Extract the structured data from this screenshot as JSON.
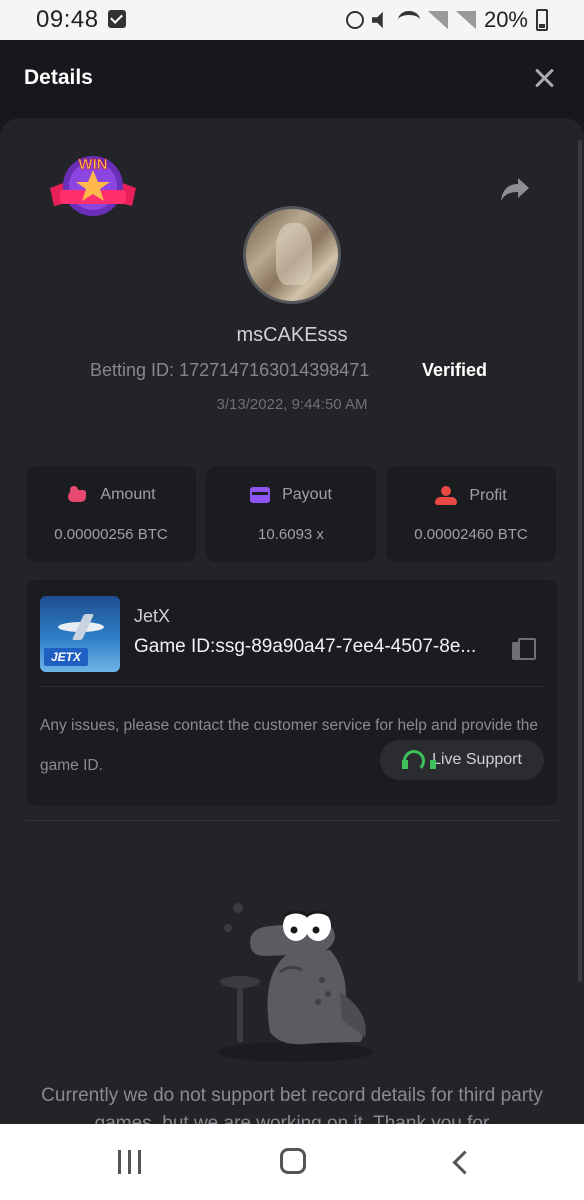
{
  "status_bar": {
    "time": "09:48",
    "battery": "20%",
    "icons": [
      "check-icon",
      "alarm-icon",
      "mute-icon",
      "wifi-icon",
      "signal-icon",
      "signal-icon",
      "battery-icon"
    ]
  },
  "header": {
    "title": "Details",
    "close_icon": "close-icon"
  },
  "profile": {
    "badge_text": "WIN",
    "username": "msCAKEsss",
    "betting_label": "Betting ID:",
    "betting_id": "1727147163014398471",
    "verified": "Verified",
    "date": "3/13/2022, 9:44:50 AM"
  },
  "stats": [
    {
      "label": "Amount",
      "value": "0.00000256 BTC",
      "icon": "amount-icon",
      "color": "#e74a6e"
    },
    {
      "label": "Payout",
      "value": "10.6093 x",
      "icon": "payout-icon",
      "color": "#8e56f5"
    },
    {
      "label": "Profit",
      "value": "0.00002460 BTC",
      "icon": "profit-icon",
      "color": "#e84b46"
    }
  ],
  "game": {
    "name": "JetX",
    "thumb_label": "JETX",
    "id_label": "Game ID:",
    "id_value": "ssg-89a90a47-7ee4-4507-8e...",
    "notice": "Any issues, please contact the customer service for help and provide the game ID.",
    "support_label": "Live Support",
    "support_color": "#3ec15b"
  },
  "third_party_message": "Currently we do not support bet record details for third party games, but we are working on it. Thank you for",
  "colors": {
    "background": "#17181c",
    "sheet": "#232428",
    "card": "#1b1c20"
  }
}
